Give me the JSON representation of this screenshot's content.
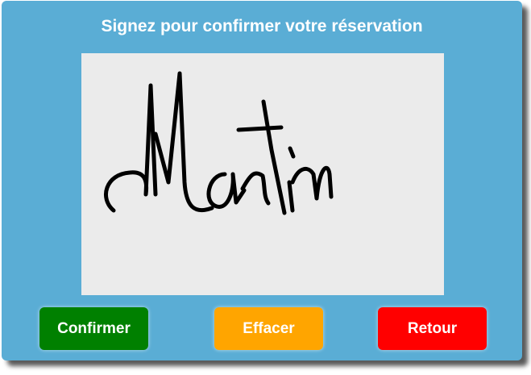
{
  "dialog": {
    "title": "Signez pour confirmer votre réservation"
  },
  "signature_pad": {
    "signature_text": "Martin",
    "background_color": "#ebebeb",
    "ink_color": "#000000"
  },
  "buttons": {
    "confirm": {
      "label": "Confirmer",
      "color": "#008000"
    },
    "clear": {
      "label": "Effacer",
      "color": "#ffa500"
    },
    "back": {
      "label": "Retour",
      "color": "#ff0000"
    }
  },
  "colors": {
    "panel": "#5aadd5",
    "title_text": "#ffffff"
  }
}
